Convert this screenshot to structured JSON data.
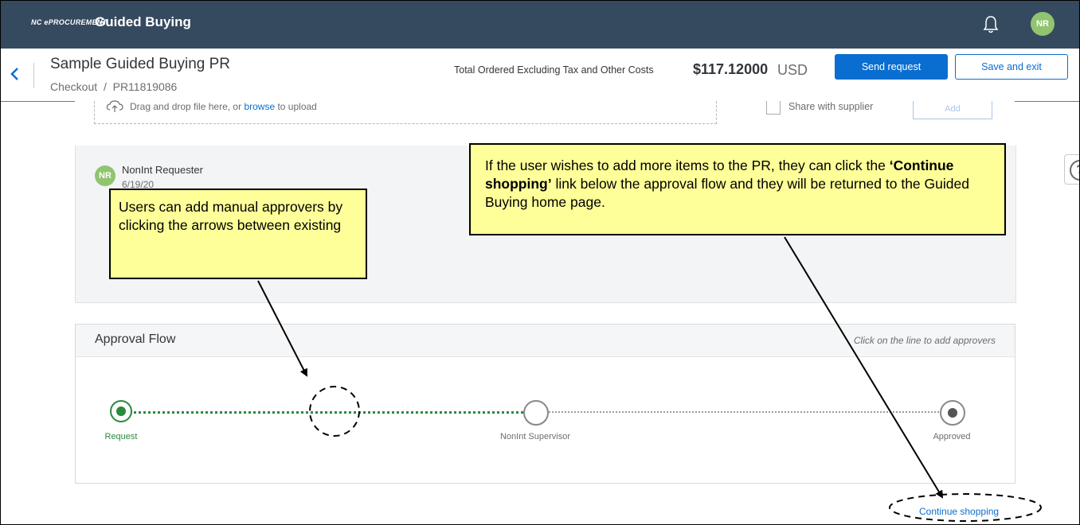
{
  "app": {
    "brand_small": "NC ePROCUREMENT",
    "brand_title": "Guided Buying",
    "bell_icon": "bell-icon",
    "user_initials": "NR"
  },
  "header": {
    "title": "Sample Guided Buying PR",
    "breadcrumb_checkout": "Checkout",
    "breadcrumb_sep": "/",
    "breadcrumb_pr": "PR11819086",
    "total_label": "Total Ordered Excluding Tax and Other Costs",
    "total_amount": "$117.12000",
    "total_currency": "USD",
    "send_label": "Send request",
    "save_label": "Save and exit"
  },
  "upload": {
    "text_before": "Drag and drop file here, or",
    "browse": "browse",
    "text_after": "to upload",
    "share_label": "Share with supplier",
    "add_label": "Add"
  },
  "comment": {
    "initials": "NR",
    "author": "NonInt Requester",
    "date": "6/19/20"
  },
  "help": {
    "symbol": "?"
  },
  "approval": {
    "title": "Approval Flow",
    "hint": "Click on the line to add approvers",
    "nodes": [
      {
        "label": "Request",
        "state": "active"
      },
      {
        "label": "NonInt Supervisor",
        "state": "pending"
      },
      {
        "label": "Approved",
        "state": "final"
      }
    ]
  },
  "continue_shopping": "Continue shopping",
  "callouts": {
    "left": "Users can add manual approvers by clicking the arrows between existing",
    "right_part1": "If the user wishes to add more items to the PR, they can click the ",
    "right_bold": "‘Continue shopping’",
    "right_part2": " link below the approval flow and they will be returned to the Guided Buying home page."
  },
  "colors": {
    "topbar": "#354a5f",
    "accent_blue": "#0a6ed1",
    "green": "#2b8a3e",
    "avatar_green": "#91c46f",
    "callout_yellow": "#ffff99"
  }
}
